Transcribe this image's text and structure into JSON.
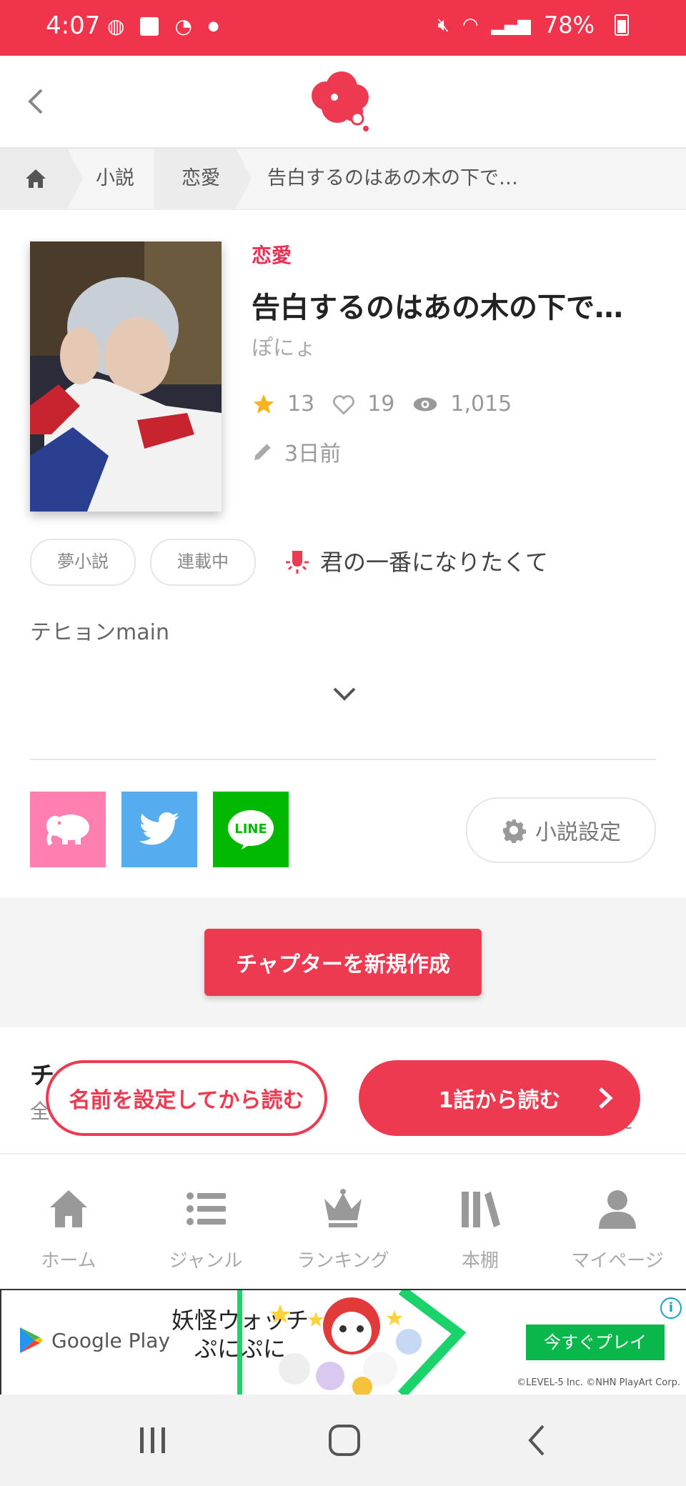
{
  "status_bar": {
    "time": "4:07",
    "battery": "78%",
    "bg_color": "#f0344c"
  },
  "header": {
    "back_icon": "chevron-left-icon",
    "logo_icon": "cloud-logo-icon"
  },
  "breadcrumb": {
    "home_icon": "home-icon",
    "items": [
      "小説",
      "恋愛",
      "告白するのはあの木の下で…"
    ]
  },
  "novel": {
    "genre": "恋愛",
    "title": "告白するのはあの木の下で…",
    "author": "ぽにょ",
    "stars": "13",
    "likes": "19",
    "views": "1,015",
    "updated": "3日前",
    "tags": [
      "夢小説",
      "連載中"
    ],
    "theme_song": "君の一番になりたくて",
    "description": "テヒョンmain"
  },
  "share": {
    "settings_label": "小説設定",
    "line_label": "LINE"
  },
  "actions": {
    "create_chapter": "チャプターを新規作成",
    "read_named": "名前を設定してから読む",
    "read_first": "1話から読む"
  },
  "chapter_peek": {
    "title": "チ",
    "sub": "全",
    "right": "え"
  },
  "bottom_nav": [
    {
      "label": "ホーム",
      "icon": "home-icon"
    },
    {
      "label": "ジャンル",
      "icon": "list-icon"
    },
    {
      "label": "ランキング",
      "icon": "crown-icon"
    },
    {
      "label": "本棚",
      "icon": "bookshelf-icon"
    },
    {
      "label": "マイページ",
      "icon": "user-icon"
    }
  ],
  "ad": {
    "store": "Google Play",
    "title_line1": "妖怪ウォッチ",
    "title_line2": "ぷにぷに",
    "cta": "今すぐプレイ",
    "copyright": "©LEVEL-5 Inc. ©NHN PlayArt Corp.",
    "info": "i"
  },
  "colors": {
    "accent": "#ee3a51",
    "twitter": "#55acee",
    "line": "#00b900",
    "app_share": "#ff7fb0"
  }
}
